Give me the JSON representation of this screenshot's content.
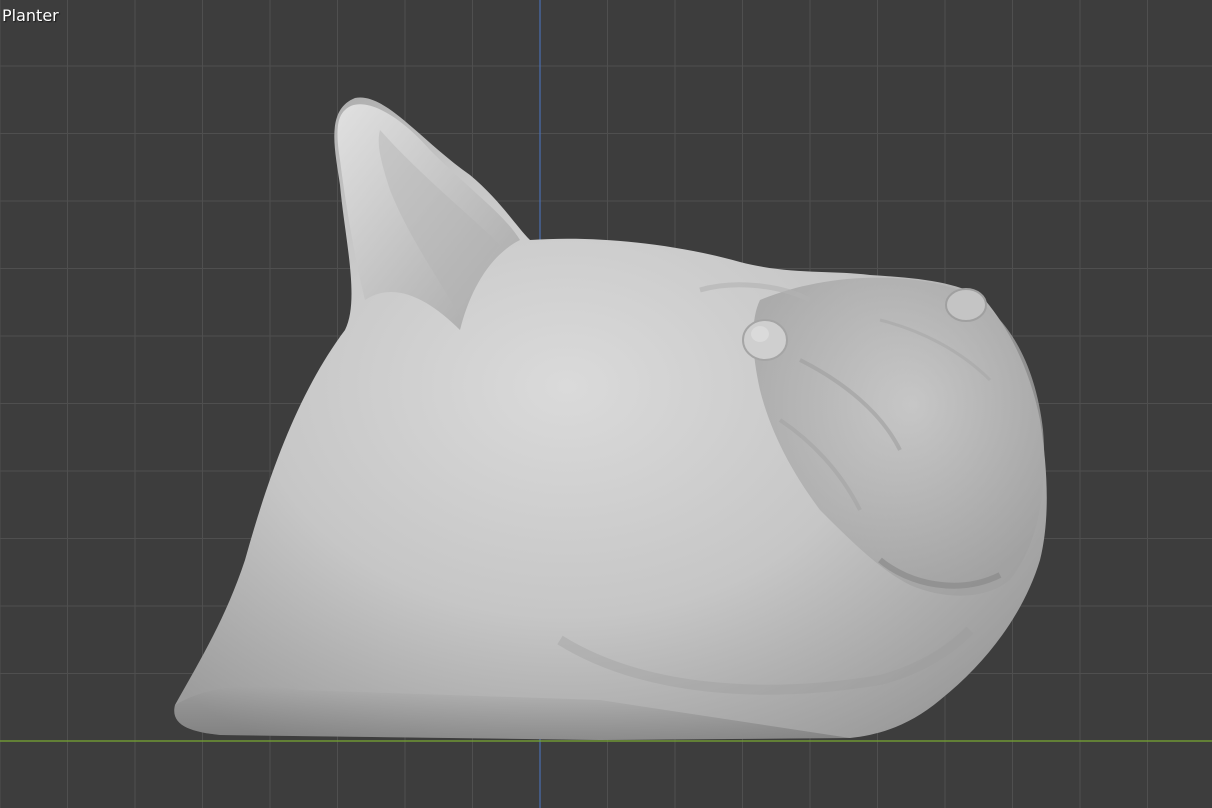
{
  "viewport": {
    "object_name": "Planter",
    "background_color": "#3d3d3d",
    "grid_color": "#4f4f4f",
    "x_axis_color": "#78a832",
    "z_axis_color": "#4a6fb0",
    "mesh_color": "#c9c9c9",
    "mesh_description_icon": "dog-head-sculpt"
  }
}
